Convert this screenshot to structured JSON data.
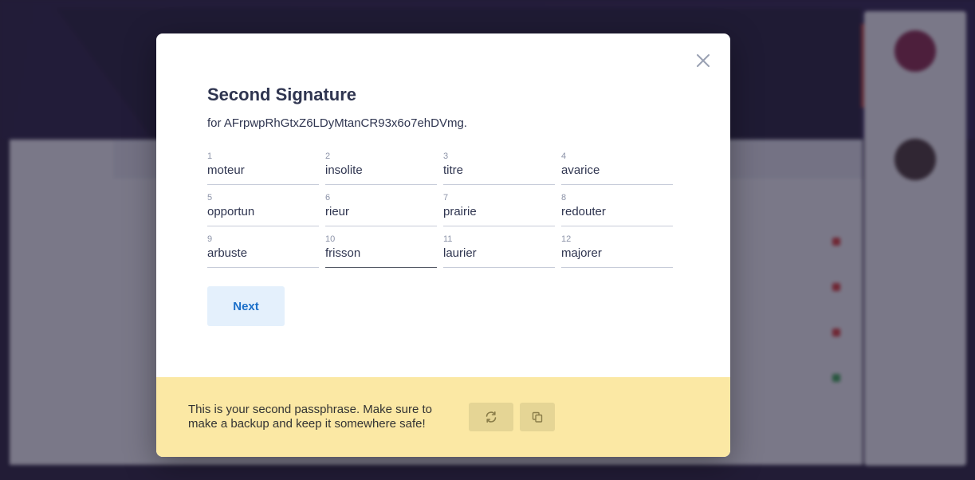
{
  "modal": {
    "title": "Second Signature",
    "subtitle": "for AFrpwpRhGtxZ6LDyMtanCR93x6o7ehDVmg.",
    "words": [
      {
        "num": "1",
        "word": "moteur"
      },
      {
        "num": "2",
        "word": "insolite"
      },
      {
        "num": "3",
        "word": "titre"
      },
      {
        "num": "4",
        "word": "avarice"
      },
      {
        "num": "5",
        "word": "opportun"
      },
      {
        "num": "6",
        "word": "rieur"
      },
      {
        "num": "7",
        "word": "prairie"
      },
      {
        "num": "8",
        "word": "redouter"
      },
      {
        "num": "9",
        "word": "arbuste"
      },
      {
        "num": "10",
        "word": "frisson"
      },
      {
        "num": "11",
        "word": "laurier"
      },
      {
        "num": "12",
        "word": "majorer"
      }
    ],
    "next_label": "Next",
    "warning": "This is your second passphrase. Make sure to make a backup and keep it somewhere safe!",
    "icons": {
      "close": "close-icon",
      "regenerate": "refresh-icon",
      "copy": "copy-icon"
    }
  },
  "colors": {
    "title": "#2f3550",
    "next_bg": "#e4f0fc",
    "next_text": "#1b6fc9",
    "footer_bg": "#fbe8a4",
    "footer_button": "#e5d595"
  }
}
